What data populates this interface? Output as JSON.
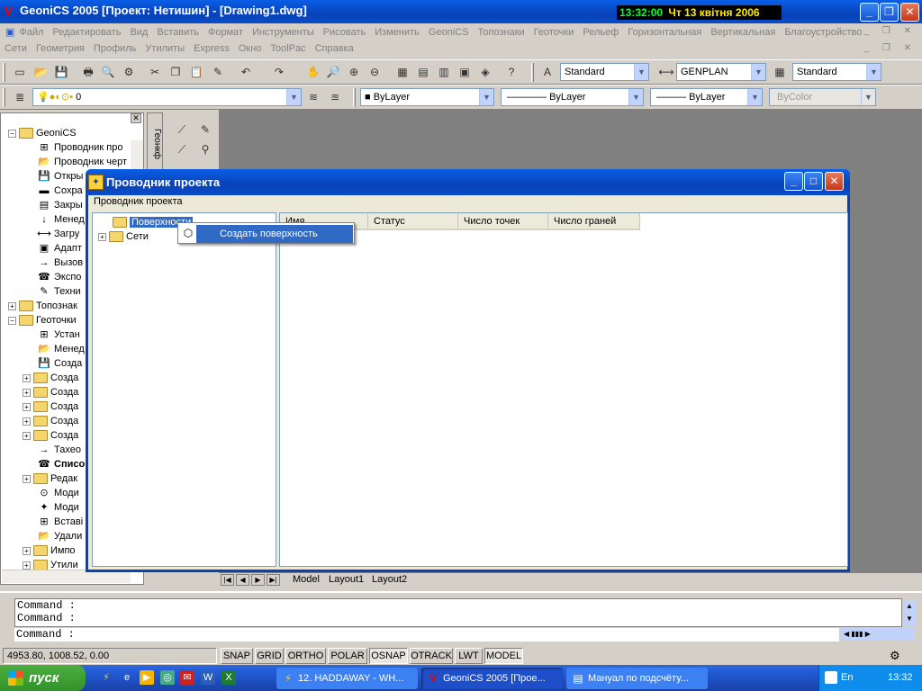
{
  "window": {
    "title": "GeoniCS 2005 [Проект: Нетишин] - [Drawing1.dwg]",
    "clock_time": "13:32:00",
    "clock_date": "Чт 13 квітня 2006",
    "min": "_",
    "max": "❐",
    "close": "✕"
  },
  "menu1": [
    "Файл",
    "Редактировать",
    "Вид",
    "Вставить",
    "Формат",
    "Инструменты",
    "Рисовать",
    "Изменить",
    "GeoniCS",
    "Топознаки",
    "Геоточки",
    "Рельеф",
    "Горизонтальная",
    "Вертикальная",
    "Благоустройство"
  ],
  "menu2": [
    "Сети",
    "Геометрия",
    "Профиль",
    "Утилиты",
    "Express",
    "Окно",
    "ToolPac",
    "Справка"
  ],
  "toolbar1": {
    "text_style": "Standard",
    "dim_style": "GENPLAN",
    "table_style": "Standard"
  },
  "toolbar2": {
    "layer": "0",
    "color": "ByLayer",
    "linetype": "ByLayer",
    "lineweight": "ByLayer",
    "plotstyle": "ByColor"
  },
  "lefttree": [
    {
      "label": "GeoniCS",
      "pm": "−",
      "kind": "folder-open",
      "indent": 0
    },
    {
      "label": "Проводник про",
      "pm": "",
      "kind": "icon",
      "indent": 2
    },
    {
      "label": "Проводник черт",
      "pm": "",
      "kind": "icon",
      "indent": 2
    },
    {
      "label": "Откры",
      "pm": "",
      "kind": "icon",
      "indent": 2
    },
    {
      "label": "Сохра",
      "pm": "",
      "kind": "icon",
      "indent": 2
    },
    {
      "label": "Закры",
      "pm": "",
      "kind": "icon",
      "indent": 2
    },
    {
      "label": "Менед",
      "pm": "",
      "kind": "icon",
      "indent": 2
    },
    {
      "label": "Загру",
      "pm": "",
      "kind": "icon",
      "indent": 2
    },
    {
      "label": "Адапт",
      "pm": "",
      "kind": "icon",
      "indent": 2
    },
    {
      "label": "Вызов",
      "pm": "",
      "kind": "icon",
      "indent": 2
    },
    {
      "label": "Экспо",
      "pm": "",
      "kind": "icon",
      "indent": 2
    },
    {
      "label": "Техни",
      "pm": "",
      "kind": "icon",
      "indent": 2
    },
    {
      "label": "Топознак",
      "pm": "+",
      "kind": "folder",
      "indent": 0
    },
    {
      "label": "Геоточки",
      "pm": "−",
      "kind": "folder-open",
      "indent": 0
    },
    {
      "label": "Устан",
      "pm": "",
      "kind": "icon",
      "indent": 2
    },
    {
      "label": "Менед",
      "pm": "",
      "kind": "icon",
      "indent": 2
    },
    {
      "label": "Созда",
      "pm": "",
      "kind": "icon",
      "indent": 2
    },
    {
      "label": "Созда",
      "pm": "+",
      "kind": "folder",
      "indent": 1
    },
    {
      "label": "Созда",
      "pm": "+",
      "kind": "folder",
      "indent": 1
    },
    {
      "label": "Созда",
      "pm": "+",
      "kind": "folder",
      "indent": 1
    },
    {
      "label": "Созда",
      "pm": "+",
      "kind": "folder",
      "indent": 1
    },
    {
      "label": "Созда",
      "pm": "+",
      "kind": "folder",
      "indent": 1
    },
    {
      "label": "Тахео",
      "pm": "",
      "kind": "icon",
      "indent": 2
    },
    {
      "label": "Списо",
      "pm": "",
      "kind": "icon",
      "indent": 2
    },
    {
      "label": "Редак",
      "pm": "+",
      "kind": "folder",
      "indent": 1
    },
    {
      "label": "Моди",
      "pm": "",
      "kind": "icon",
      "indent": 2
    },
    {
      "label": "Моди",
      "pm": "",
      "kind": "icon",
      "indent": 2
    },
    {
      "label": "Вставі",
      "pm": "",
      "kind": "icon",
      "indent": 2
    },
    {
      "label": "Удали",
      "pm": "",
      "kind": "icon",
      "indent": 2
    },
    {
      "label": "Импо",
      "pm": "+",
      "kind": "folder",
      "indent": 1
    },
    {
      "label": "Утили",
      "pm": "+",
      "kind": "folder",
      "indent": 1
    }
  ],
  "side_tab": "Геонкф",
  "layout_tabs": [
    "Model",
    "Layout1",
    "Layout2"
  ],
  "dialog": {
    "title": "Проводник проекта",
    "menu": "Проводник проекта",
    "tree": [
      {
        "label": "Поверхности",
        "pm": "",
        "selected": true
      },
      {
        "label": "Сети",
        "pm": "+",
        "selected": false
      }
    ],
    "columns": [
      "Имя",
      "Статус",
      "Число точек",
      "Число граней"
    ]
  },
  "context_menu": {
    "item": "Создать поверхность"
  },
  "command": {
    "line1": "Command :",
    "line2": "Command :",
    "input": "Command :"
  },
  "status": {
    "coords": "4953.80, 1008.52, 0.00",
    "buttons": [
      {
        "label": "SNAP",
        "on": false
      },
      {
        "label": "GRID",
        "on": false
      },
      {
        "label": "ORTHO",
        "on": false
      },
      {
        "label": "POLAR",
        "on": false
      },
      {
        "label": "OSNAP",
        "on": true
      },
      {
        "label": "OTRACK",
        "on": false
      },
      {
        "label": "LWT",
        "on": false
      },
      {
        "label": "MODEL",
        "on": true
      }
    ]
  },
  "taskbar": {
    "start": "пуск",
    "tasks": [
      {
        "label": "12. HADDAWAY - WH...",
        "active": false
      },
      {
        "label": "GeoniCS 2005 [Прое...",
        "active": true
      },
      {
        "label": "Мануал по подсчёту...",
        "active": false
      }
    ],
    "lang1": "EN",
    "lang2": "En",
    "time": "13:32"
  }
}
